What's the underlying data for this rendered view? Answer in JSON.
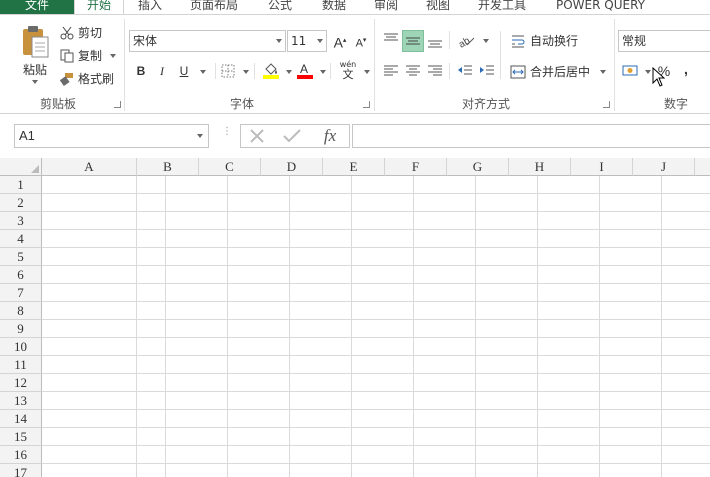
{
  "tabs": {
    "file": "文件",
    "home": "开始",
    "insert": "插入",
    "page_layout": "页面布局",
    "formulas": "公式",
    "data": "数据",
    "review": "审阅",
    "view": "视图",
    "developer": "开发工具",
    "power_query": "POWER QUERY"
  },
  "clipboard": {
    "paste": "粘贴",
    "cut": "剪切",
    "copy": "复制",
    "format_painter": "格式刷",
    "group_label": "剪贴板"
  },
  "font": {
    "name": "宋体",
    "size": "11",
    "bold": "B",
    "italic": "I",
    "underline": "U",
    "phonetic_top": "wén",
    "phonetic_bottom": "文",
    "group_label": "字体",
    "fill_color": "#FFFF00",
    "font_color": "#FF0000"
  },
  "alignment": {
    "wrap_text": "自动换行",
    "merge_center": "合并后居中",
    "group_label": "对齐方式"
  },
  "number": {
    "format": "常规",
    "percent": "%",
    "comma": ",",
    "group_label": "数字"
  },
  "formula_bar": {
    "name_box": "A1",
    "fx": "fx",
    "content": ""
  },
  "grid": {
    "columns": [
      "A",
      "B",
      "C",
      "D",
      "E",
      "F",
      "G",
      "H",
      "I",
      "J"
    ],
    "rows": [
      "1",
      "2",
      "3",
      "4",
      "5",
      "6",
      "7",
      "8",
      "9",
      "10",
      "11",
      "12",
      "13",
      "14",
      "15",
      "16",
      "17"
    ]
  },
  "colors": {
    "accent": "#217346",
    "active_align": "#9fd5b7"
  }
}
